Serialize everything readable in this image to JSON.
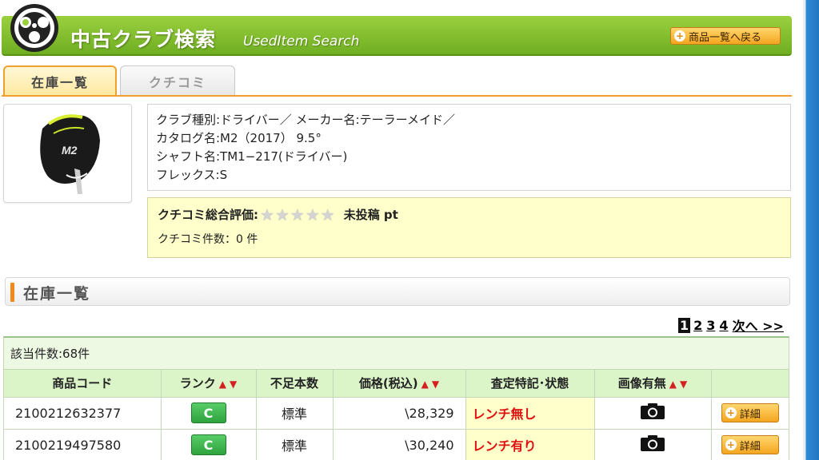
{
  "header": {
    "title": "中古クラブ検索",
    "subtitle": "UsedItem Search",
    "back_button": "商品一覧へ戻る"
  },
  "tabs": [
    {
      "label": "在庫一覧",
      "active": true
    },
    {
      "label": "クチコミ",
      "active": false
    }
  ],
  "product": {
    "image_text": "M2",
    "lines": [
      "クラブ種別:ドライバー／ メーカー名:テーラーメイド／",
      "カタログ名:M2（2017） 9.5°",
      "シャフト名:TM1−217(ドライバー)",
      "フレックス:S"
    ]
  },
  "review": {
    "rating_label": "クチコミ総合評価:",
    "stars_filled": 0,
    "stars_total": 5,
    "rating_value": "未投稿 pt",
    "count_text": "クチコミ件数：0 件"
  },
  "section": {
    "title": "在庫一覧"
  },
  "pager": {
    "current": "1",
    "pages": [
      "2",
      "3",
      "4"
    ],
    "next": "次へ >>"
  },
  "results": {
    "count": "該当件数:68件",
    "columns": [
      "商品コード",
      "ランク",
      "不足本数",
      "価格(税込)",
      "査定特記･状態",
      "画像有無",
      ""
    ],
    "sort_up": "▲",
    "sort_down": "▼",
    "detail_label": "詳細",
    "rows": [
      {
        "code": "2100212632377",
        "rank": "C",
        "shortage": "標準",
        "price": "\\28,329",
        "condition": "レンチ無し"
      },
      {
        "code": "2100219497580",
        "rank": "C",
        "shortage": "標準",
        "price": "\\30,240",
        "condition": "レンチ有り"
      }
    ]
  },
  "colors": {
    "header_green": "#7fbf2e",
    "accent_orange": "#f08a1c",
    "table_header": "#dbf5c8",
    "condition_red": "#e01010"
  }
}
